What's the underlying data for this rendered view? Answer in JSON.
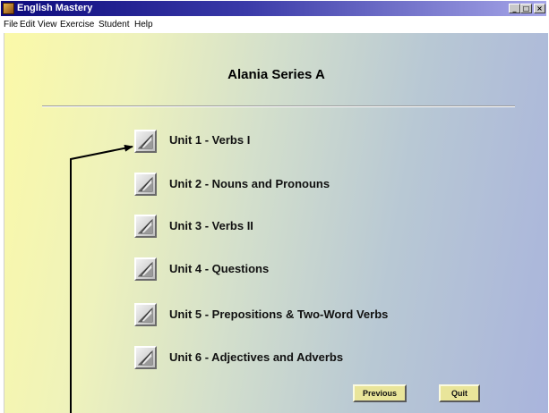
{
  "window": {
    "title": "English Mastery",
    "controls": {
      "minimize": "_",
      "maximize": "□",
      "close": "×"
    }
  },
  "menu": [
    "File",
    "Edit",
    "View",
    "Exercise",
    "Student",
    "Help"
  ],
  "series_title": "Alania Series A",
  "units": [
    {
      "label": "Unit 1 - Verbs I"
    },
    {
      "label": "Unit 2 - Nouns and Pronouns"
    },
    {
      "label": "Unit 3 - Verbs II"
    },
    {
      "label": "Unit 4 - Questions"
    },
    {
      "label": "Unit 5 - Prepositions & Two-Word Verbs"
    },
    {
      "label": "Unit 6 - Adjectives and Adverbs"
    }
  ],
  "buttons": {
    "previous": "Previous",
    "quit": "Quit"
  },
  "icons": {
    "unit_button_icon": "pencil-ruler-icon",
    "app_icon": "book-icon"
  },
  "colors": {
    "title_bar": "#0c0a7c",
    "nav_button": "#e9e59a",
    "callout_arrow": "#000000"
  }
}
